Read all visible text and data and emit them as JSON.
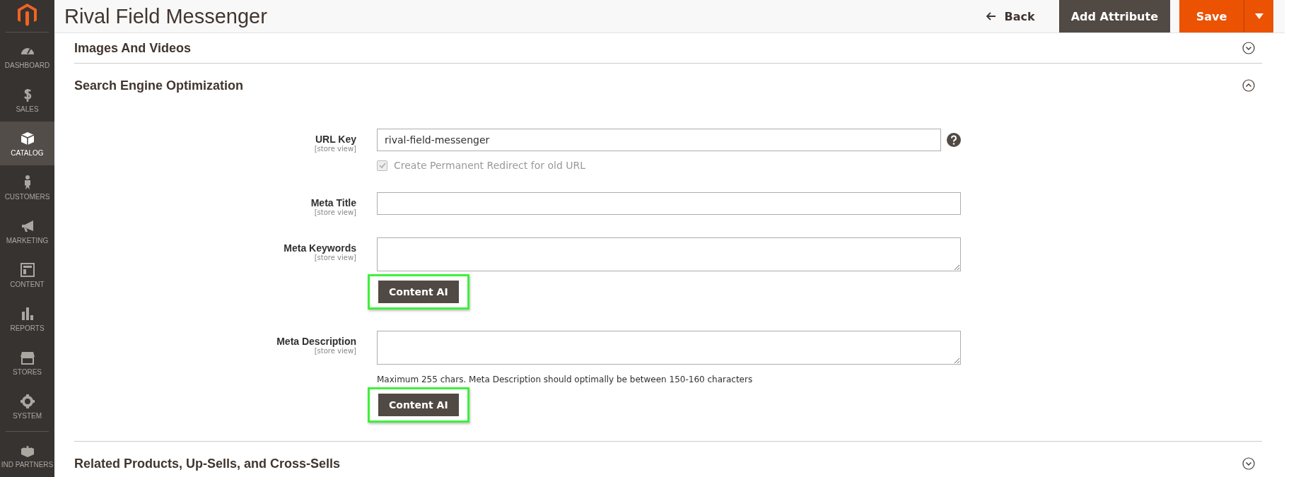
{
  "sidebar": {
    "items": [
      {
        "label": "DASHBOARD",
        "selected": false
      },
      {
        "label": "SALES",
        "selected": false
      },
      {
        "label": "CATALOG",
        "selected": true
      },
      {
        "label": "CUSTOMERS",
        "selected": false
      },
      {
        "label": "MARKETING",
        "selected": false
      },
      {
        "label": "CONTENT",
        "selected": false
      },
      {
        "label": "REPORTS",
        "selected": false
      },
      {
        "label": "STORES",
        "selected": false
      },
      {
        "label": "SYSTEM",
        "selected": false
      },
      {
        "label": "IND PARTNERS",
        "selected": false
      }
    ]
  },
  "header": {
    "title": "Rival Field Messenger",
    "back": "Back",
    "add_attribute": "Add Attribute",
    "save": "Save"
  },
  "sections": [
    {
      "title": "Images And Videos",
      "expanded": false
    },
    {
      "title": "Search Engine Optimization",
      "expanded": true,
      "fields": [
        {
          "label": "URL Key",
          "scope": "[store view]",
          "kind": "input",
          "value": "rival-field-messenger",
          "help": true,
          "checkbox": {
            "label": "Create Permanent Redirect for old URL",
            "checked": true,
            "disabled": true
          }
        },
        {
          "label": "Meta Title",
          "scope": "[store view]",
          "kind": "input"
        },
        {
          "label": "Meta Keywords",
          "scope": "[store view]",
          "kind": "textarea",
          "button": {
            "label": "Content AI",
            "highlighted": true
          }
        },
        {
          "label": "Meta Description",
          "scope": "[store view]",
          "kind": "textarea",
          "note": "Maximum 255 chars. Meta Description should optimally be between 150-160 characters",
          "button": {
            "label": "Content AI",
            "highlighted": true
          }
        }
      ]
    },
    {
      "title": "Related Products, Up-Sells, and Cross-Sells",
      "expanded": false
    }
  ]
}
